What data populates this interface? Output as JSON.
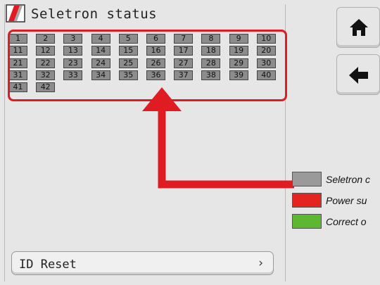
{
  "header": {
    "title": "Seletron status",
    "logo_icon": "brand-logo-icon"
  },
  "modules": [
    "1",
    "2",
    "3",
    "4",
    "5",
    "6",
    "7",
    "8",
    "9",
    "10",
    "11",
    "12",
    "13",
    "14",
    "15",
    "16",
    "17",
    "18",
    "19",
    "20",
    "21",
    "22",
    "23",
    "24",
    "25",
    "26",
    "27",
    "28",
    "29",
    "30",
    "31",
    "32",
    "33",
    "34",
    "35",
    "36",
    "37",
    "38",
    "39",
    "40",
    "41",
    "42"
  ],
  "nav": {
    "home_icon": "home-icon",
    "back_icon": "arrow-left-icon"
  },
  "reset_button": {
    "label": "ID Reset",
    "chevron": "›"
  },
  "legend": [
    {
      "color": "#9a9a9a",
      "text": "Seletron c"
    },
    {
      "color": "#e52420",
      "text": "Power su"
    },
    {
      "color": "#5cb82e",
      "text": "Correct o"
    }
  ],
  "colors": {
    "cell": "#8c8c8c",
    "highlight": "#e01c22",
    "arrow": "#e01c22"
  }
}
